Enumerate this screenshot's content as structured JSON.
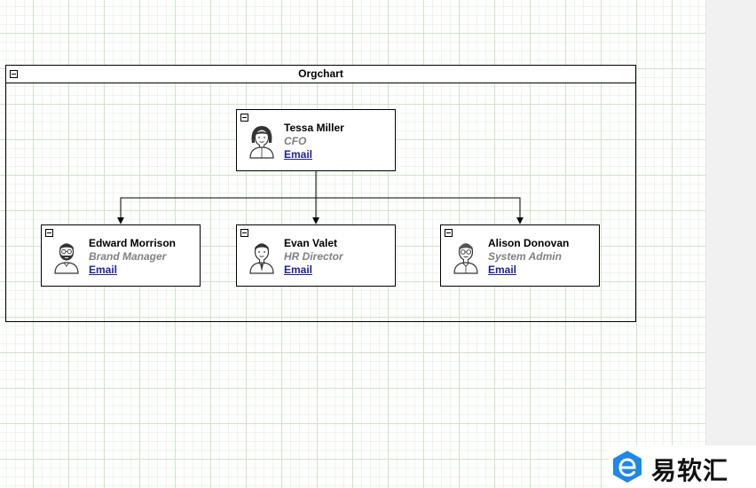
{
  "diagram": {
    "container": {
      "title": "Orgchart"
    },
    "nodes": [
      {
        "id": "tessa",
        "name": "Tessa Miller",
        "role": "CFO",
        "link": "Email",
        "avatar": "woman-avatar-icon"
      },
      {
        "id": "edward",
        "name": "Edward Morrison",
        "role": "Brand Manager",
        "link": "Email",
        "avatar": "bearded-man-avatar-icon"
      },
      {
        "id": "evan",
        "name": "Evan Valet",
        "role": "HR Director",
        "link": "Email",
        "avatar": "man-tie-avatar-icon"
      },
      {
        "id": "alison",
        "name": "Alison Donovan",
        "role": "System Admin",
        "link": "Email",
        "avatar": "man-glasses-avatar-icon"
      }
    ],
    "edges": [
      {
        "from": "tessa",
        "to": "edward"
      },
      {
        "from": "tessa",
        "to": "evan"
      },
      {
        "from": "tessa",
        "to": "alison"
      }
    ]
  },
  "watermark": {
    "text": "易软汇",
    "logo_icon": "e-logo-icon",
    "color": "#1e88e5"
  },
  "colors": {
    "grid": "#cfe3c6",
    "link": "#1f1f9b",
    "role": "#808080"
  }
}
